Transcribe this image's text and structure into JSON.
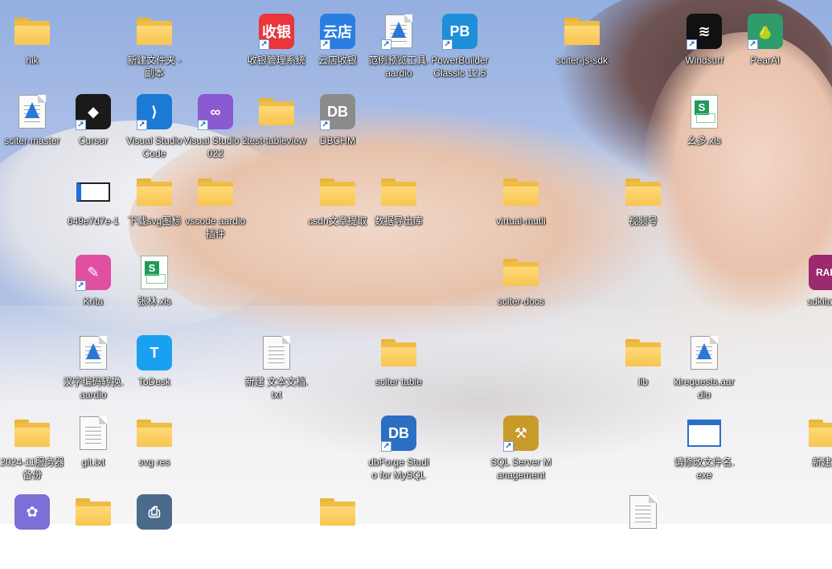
{
  "desktop": {
    "icons": [
      {
        "label": "hik",
        "icon": "folder-icon",
        "kind": "folder"
      },
      {
        "label": "新建文件夹 - 副本",
        "icon": "folder-icon",
        "kind": "folder"
      },
      {
        "label": "收银管理系统",
        "icon": "cashier-app-icon",
        "kind": "app",
        "badge": "收银",
        "color": "#e8363b",
        "shortcut": true
      },
      {
        "label": "云店收银",
        "icon": "cloud-store-app-icon",
        "kind": "app",
        "badge": "云店",
        "color": "#2a7de1",
        "shortcut": true
      },
      {
        "label": "范例预览工具.aardio",
        "icon": "aardio-file-icon",
        "kind": "aardio",
        "shortcut": true
      },
      {
        "label": "PowerBuilder Classic 12.5",
        "icon": "powerbuilder-icon",
        "kind": "app",
        "badge": "PB",
        "color": "#1e8fd8",
        "shortcut": true
      },
      {
        "label": "sciter-js-sdk",
        "icon": "folder-icon",
        "kind": "folder"
      },
      {
        "label": "Windsurf",
        "icon": "windsurf-icon",
        "kind": "app",
        "badge": "≋",
        "color": "#111111",
        "shortcut": true
      },
      {
        "label": "PearAI",
        "icon": "pearai-icon",
        "kind": "app",
        "badge": "🍐",
        "color": "#2e9c6b",
        "shortcut": true
      },
      {
        "label": "sciter-master",
        "icon": "aardio-file-icon",
        "kind": "aardio"
      },
      {
        "label": "Cursor",
        "icon": "cursor-icon",
        "kind": "app",
        "badge": "◆",
        "color": "#1a1a1a",
        "shortcut": true
      },
      {
        "label": "Visual Studio Code",
        "icon": "vscode-icon",
        "kind": "app",
        "badge": "⟩",
        "color": "#1a7ad4",
        "shortcut": true
      },
      {
        "label": "Visual Studio 2022",
        "icon": "visual-studio-icon",
        "kind": "app",
        "badge": "∞",
        "color": "#8a5ad0",
        "shortcut": true
      },
      {
        "label": "test-tableview",
        "icon": "zip-folder-icon",
        "kind": "folder"
      },
      {
        "label": "DBCHM",
        "icon": "database-icon",
        "kind": "app",
        "badge": "DB",
        "color": "#8b8b8b",
        "shortcut": true
      },
      {
        "label": "幺多.xls",
        "icon": "spreadsheet-icon",
        "kind": "xls"
      },
      {
        "label": "649e7d7e-1",
        "icon": "image-file-icon",
        "kind": "image"
      },
      {
        "label": "下载svg图标",
        "icon": "folder-icon",
        "kind": "folder"
      },
      {
        "label": "vscode aardio插件",
        "icon": "folder-icon",
        "kind": "folder"
      },
      {
        "label": "csdn文章提取",
        "icon": "folder-icon",
        "kind": "folder"
      },
      {
        "label": "数据导出库",
        "icon": "folder-icon",
        "kind": "folder"
      },
      {
        "label": "virtual-mutli",
        "icon": "zip-folder-icon",
        "kind": "folder"
      },
      {
        "label": "视频号",
        "icon": "folder-icon",
        "kind": "folder"
      },
      {
        "label": "Krita",
        "icon": "krita-icon",
        "kind": "app",
        "badge": "✎",
        "color": "#e04fa0",
        "shortcut": true
      },
      {
        "label": "张林.xls",
        "icon": "spreadsheet-icon",
        "kind": "xls"
      },
      {
        "label": "sciter-docs",
        "icon": "folder-icon",
        "kind": "folder"
      },
      {
        "label": "sdkitable",
        "icon": "winrar-icon",
        "kind": "app",
        "badge": "RAR",
        "color": "#9b2a6e"
      },
      {
        "label": "汉字编码转换.aardio",
        "icon": "aardio-file-icon",
        "kind": "aardio"
      },
      {
        "label": "ToDesk",
        "icon": "todesk-icon",
        "kind": "app",
        "badge": "T",
        "color": "#1aa0f0"
      },
      {
        "label": "新建 文本文档.txt",
        "icon": "text-file-icon",
        "kind": "txt"
      },
      {
        "label": "sciter table",
        "icon": "folder-icon",
        "kind": "folder"
      },
      {
        "label": "lib",
        "icon": "folder-icon",
        "kind": "folder"
      },
      {
        "label": "kirequests.aardio",
        "icon": "aardio-file-icon",
        "kind": "aardio"
      },
      {
        "label": "2024-11服务器备份",
        "icon": "folder-icon",
        "kind": "folder"
      },
      {
        "label": "git.txt",
        "icon": "text-file-icon",
        "kind": "txt"
      },
      {
        "label": "svg res",
        "icon": "folder-icon",
        "kind": "folder"
      },
      {
        "label": "dbForge Studio for MySQL",
        "icon": "dbforge-icon",
        "kind": "app",
        "badge": "DB",
        "color": "#2b6fc2",
        "shortcut": true
      },
      {
        "label": "SQL Server Management",
        "icon": "sql-server-icon",
        "kind": "app",
        "badge": "⚒",
        "color": "#c79a2a",
        "shortcut": true
      },
      {
        "label": "请修改文件名.exe",
        "icon": "exe-window-icon",
        "kind": "exe"
      },
      {
        "label": "新建文",
        "icon": "folder-icon",
        "kind": "folder"
      },
      {
        "label": "",
        "icon": "flower-app-icon",
        "kind": "app",
        "badge": "✿",
        "color": "#7b6fd8"
      },
      {
        "label": "",
        "icon": "folder-icon",
        "kind": "folder"
      },
      {
        "label": "",
        "icon": "printer-icon",
        "kind": "app",
        "badge": "⎙",
        "color": "#4b6b8c"
      },
      {
        "label": "",
        "icon": "folder-icon",
        "kind": "folder"
      },
      {
        "label": "",
        "icon": "text-file-icon",
        "kind": "txt"
      }
    ]
  }
}
